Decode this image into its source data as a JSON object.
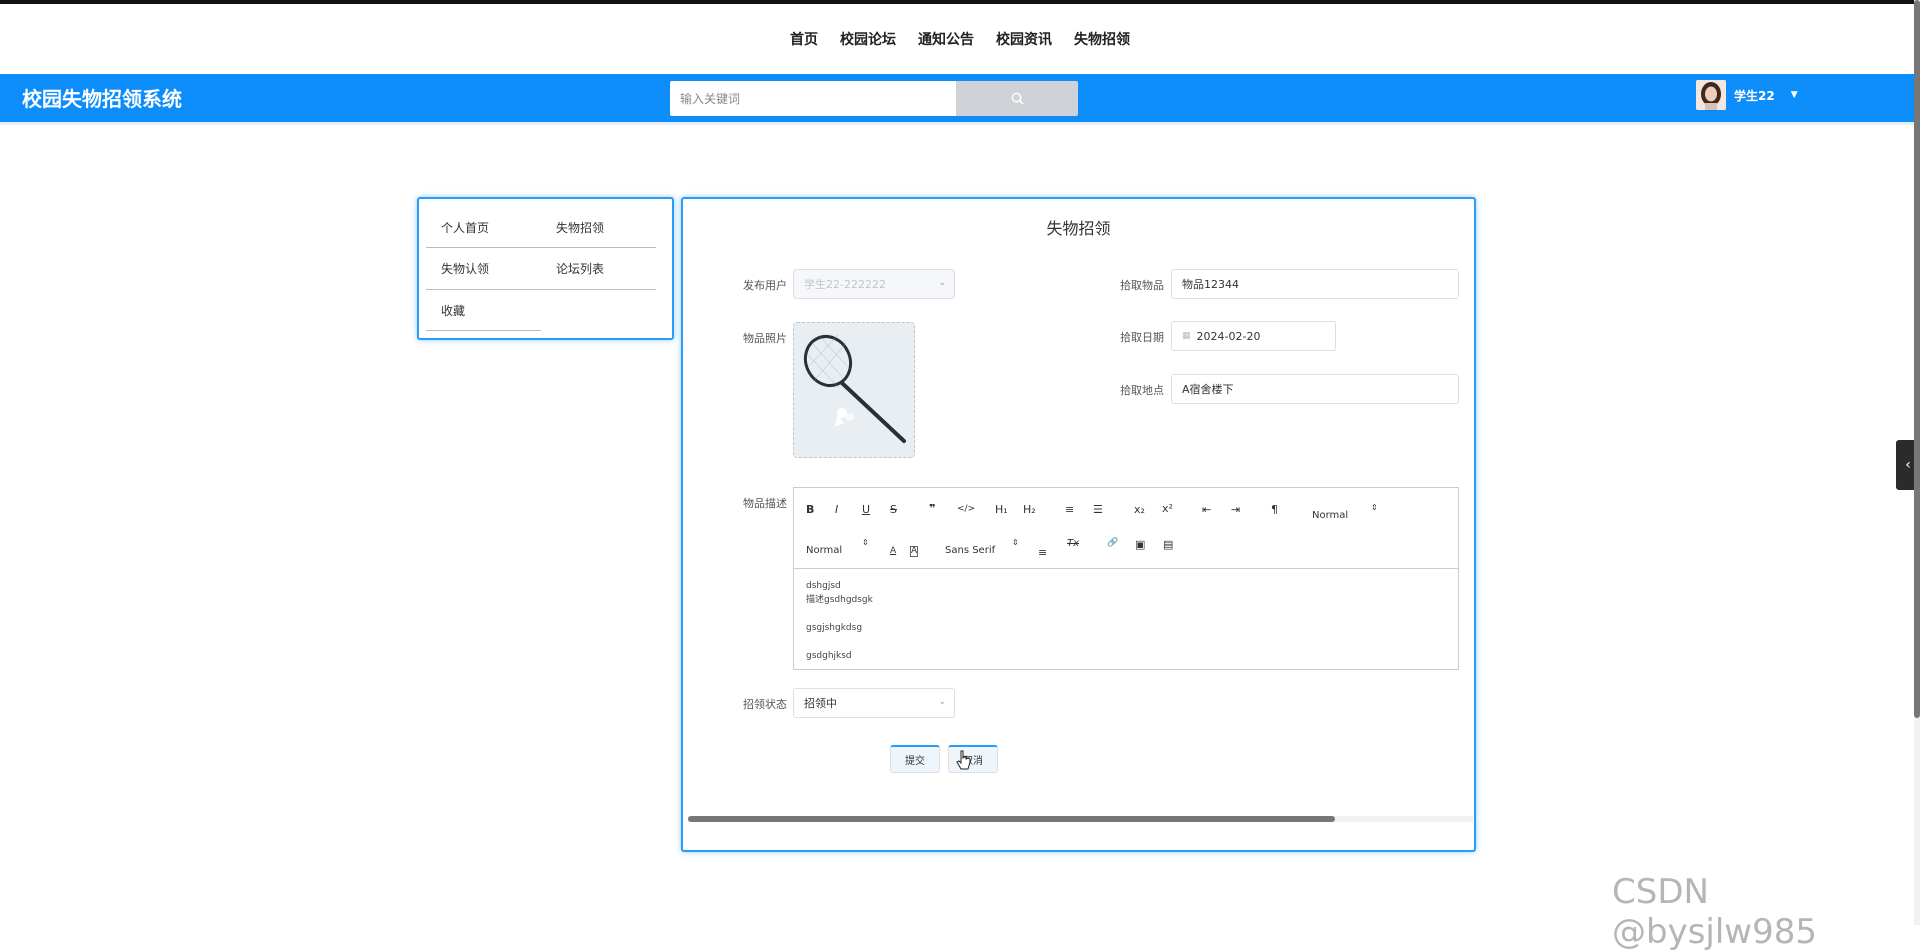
{
  "topnav": {
    "items": [
      "首页",
      "校园论坛",
      "通知公告",
      "校园资讯",
      "失物招领"
    ]
  },
  "header": {
    "brand": "校园失物招领系统",
    "search_placeholder": "输入关键词",
    "username": "学生22"
  },
  "sidebar": {
    "items": [
      "个人首页",
      "失物招领",
      "失物认领",
      "论坛列表",
      "收藏"
    ]
  },
  "form": {
    "title": "失物招领",
    "labels": {
      "publisher": "发布用户",
      "item_name": "拾取物品",
      "photo": "物品照片",
      "pickup_date": "拾取日期",
      "pickup_place": "拾取地点",
      "description": "物品描述",
      "status": "招领状态"
    },
    "values": {
      "publisher": "学生22-222222",
      "item_name": "物品12344",
      "pickup_date": "2024-02-20",
      "pickup_place": "A宿舍楼下",
      "status": "招领中"
    },
    "editor": {
      "toolbar": {
        "bold": "B",
        "italic": "I",
        "underline": "U",
        "strike": "S",
        "quote": "❞",
        "code": "</>",
        "h1": "H₁",
        "h2": "H₂",
        "ordered": "≡",
        "bullet": "☰",
        "sub": "x₂",
        "sup": "x²",
        "outdent": "⇤",
        "indent": "⇥",
        "direction": "¶",
        "size": "Normal",
        "header": "Normal",
        "font": "Sans Serif",
        "align": "≡",
        "clean": "Tx",
        "link": "🔗",
        "image": "▣",
        "video": "▤"
      },
      "content": [
        "dshgjsd",
        "描述gsdhgdsgk",
        "",
        "gsgjshgkdsg",
        "",
        "gsdghjksd"
      ]
    },
    "buttons": {
      "submit": "提交",
      "cancel": "取消"
    }
  },
  "watermark": "CSDN @bysjlw985"
}
